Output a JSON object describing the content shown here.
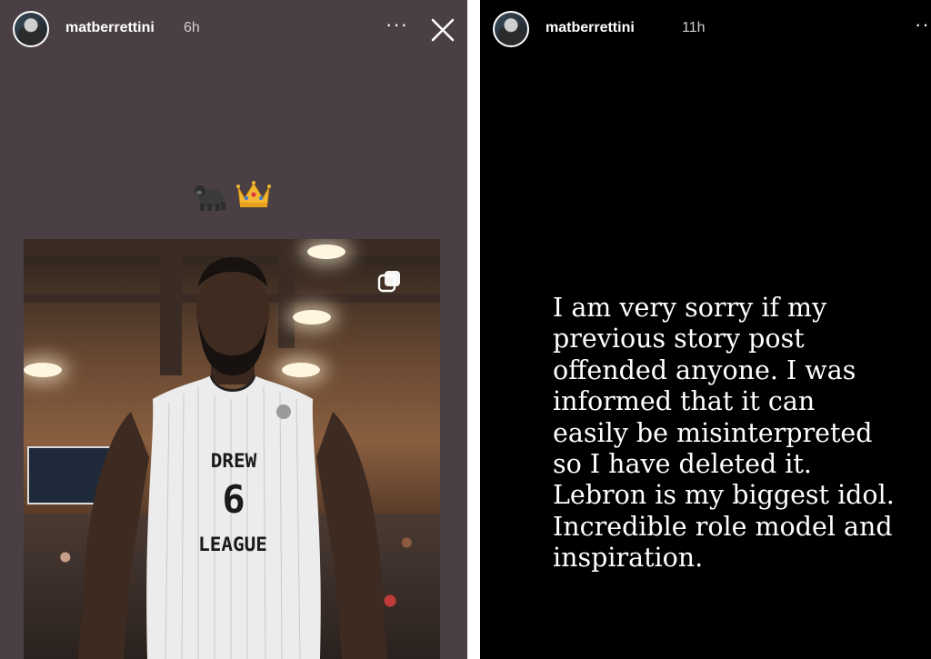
{
  "left_story": {
    "username": "matberretti­ni",
    "timestamp": "6h",
    "more_label": "···",
    "emojis": [
      "gorilla-icon",
      "crown-icon"
    ],
    "photo": {
      "jersey_line1": "DREW",
      "jersey_number": "6",
      "jersey_line2": "LEAGUE"
    }
  },
  "right_story": {
    "username": "matberrettini",
    "timestamp": "11h",
    "more_label": "···",
    "message": "I am very sorry if my\nprevious story post\noffended anyone. I was\ninformed that it can\neasily be misinterpreted\nso I have deleted it.\nLebron is my biggest idol.\nIncredible role model and\ninspiration."
  },
  "colors": {
    "left_bg": "#4a3f44",
    "right_bg": "#000000",
    "text": "#ffffff"
  }
}
